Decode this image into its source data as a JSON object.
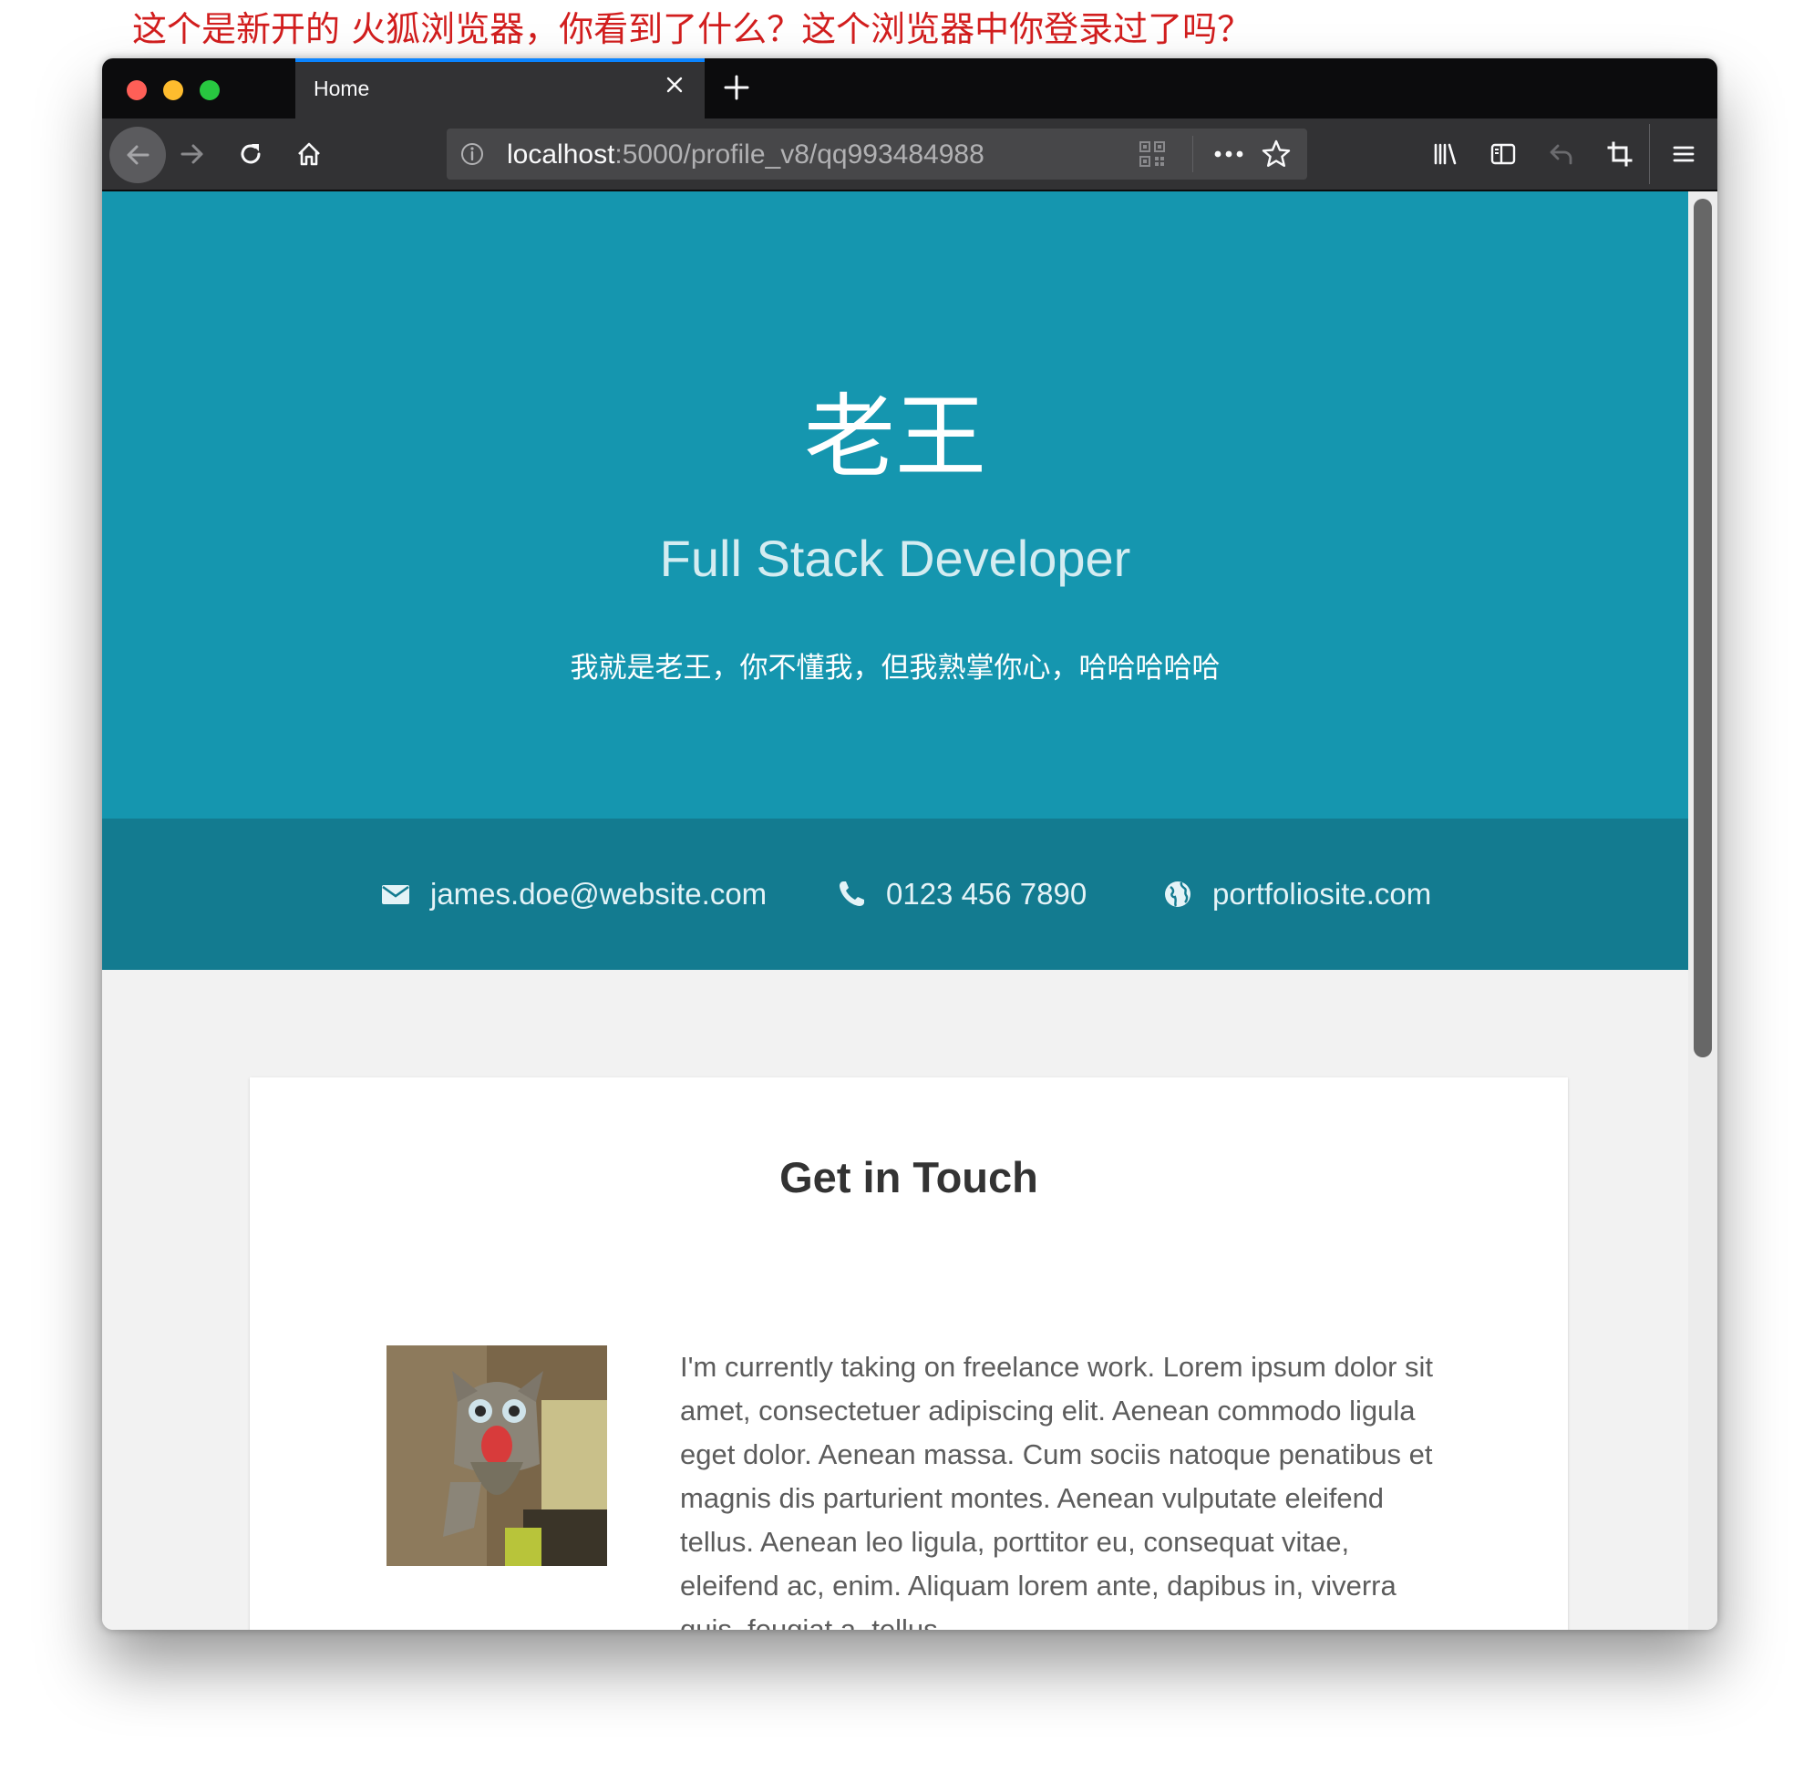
{
  "annotation": "这个是新开的 火狐浏览器，你看到了什么？这个浏览器中你登录过了吗？",
  "browser": {
    "tab": {
      "title": "Home"
    },
    "address_bar": {
      "host": "localhost",
      "path": ":5000/profile_v8/qq993484988"
    }
  },
  "hero": {
    "name": "老王",
    "title": "Full Stack Developer",
    "tagline": "我就是老王，你不懂我，但我熟掌你心，哈哈哈哈哈"
  },
  "contact": {
    "email": "james.doe@website.com",
    "phone": "0123 456 7890",
    "website": "portfoliosite.com"
  },
  "get_in_touch": {
    "title": "Get in Touch",
    "body": "I'm currently taking on freelance work. Lorem ipsum dolor sit amet, consectetuer adipiscing elit. Aenean commodo ligula eget dolor. Aenean massa. Cum sociis natoque penatibus et magnis dis parturient montes. Aenean vulputate eleifend tellus. Aenean leo ligula, porttitor eu, consequat vitae, eleifend ac, enim. Aliquam lorem ante, dapibus in, viverra quis, feugiat a, tellus."
  },
  "colors": {
    "hero_bg": "#1596af",
    "contact_band_bg": "#137b90",
    "annotation_text": "#d21e1e",
    "tab_accent": "#0a84ff"
  },
  "icons": {
    "contact": [
      "envelope-icon",
      "phone-icon",
      "globe-icon"
    ],
    "toolbar": [
      "back-arrow-icon",
      "forward-arrow-icon",
      "reload-icon",
      "home-icon",
      "library-icon",
      "sidebar-icon",
      "undo-icon",
      "crop-icon",
      "hamburger-menu-icon"
    ]
  }
}
